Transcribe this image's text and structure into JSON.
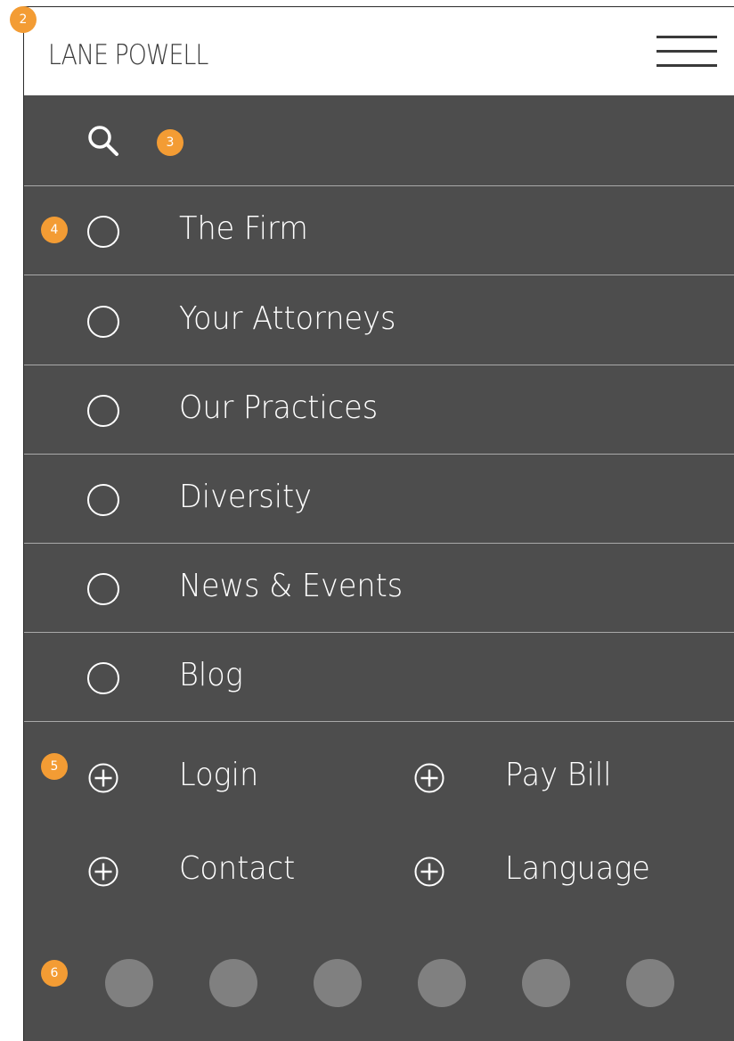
{
  "header": {
    "logo": "LANE POWELL",
    "menu_icon": "hamburger-icon"
  },
  "search": {
    "icon": "search-icon"
  },
  "nav": {
    "items": [
      {
        "label": "The Firm"
      },
      {
        "label": "Your Attorneys"
      },
      {
        "label": "Our Practices"
      },
      {
        "label": "Diversity"
      },
      {
        "label": "News & Events"
      },
      {
        "label": "Blog"
      }
    ]
  },
  "utility": {
    "items": [
      {
        "label": "Login",
        "icon": "plus-circle-icon"
      },
      {
        "label": "Pay Bill",
        "icon": "plus-circle-icon"
      },
      {
        "label": "Contact",
        "icon": "plus-circle-icon"
      },
      {
        "label": "Language",
        "icon": "plus-circle-icon"
      }
    ]
  },
  "social": {
    "count": 6,
    "color": "#808080"
  },
  "annotations": {
    "a2": "2",
    "a3": "3",
    "a4": "4",
    "a5": "5",
    "a6": "6"
  },
  "colors": {
    "menu_bg": "#4d4d4d",
    "divider": "#a9a9a9",
    "badge": "#f39c34",
    "text": "#ffffff",
    "logo": "#3b3b3b"
  }
}
